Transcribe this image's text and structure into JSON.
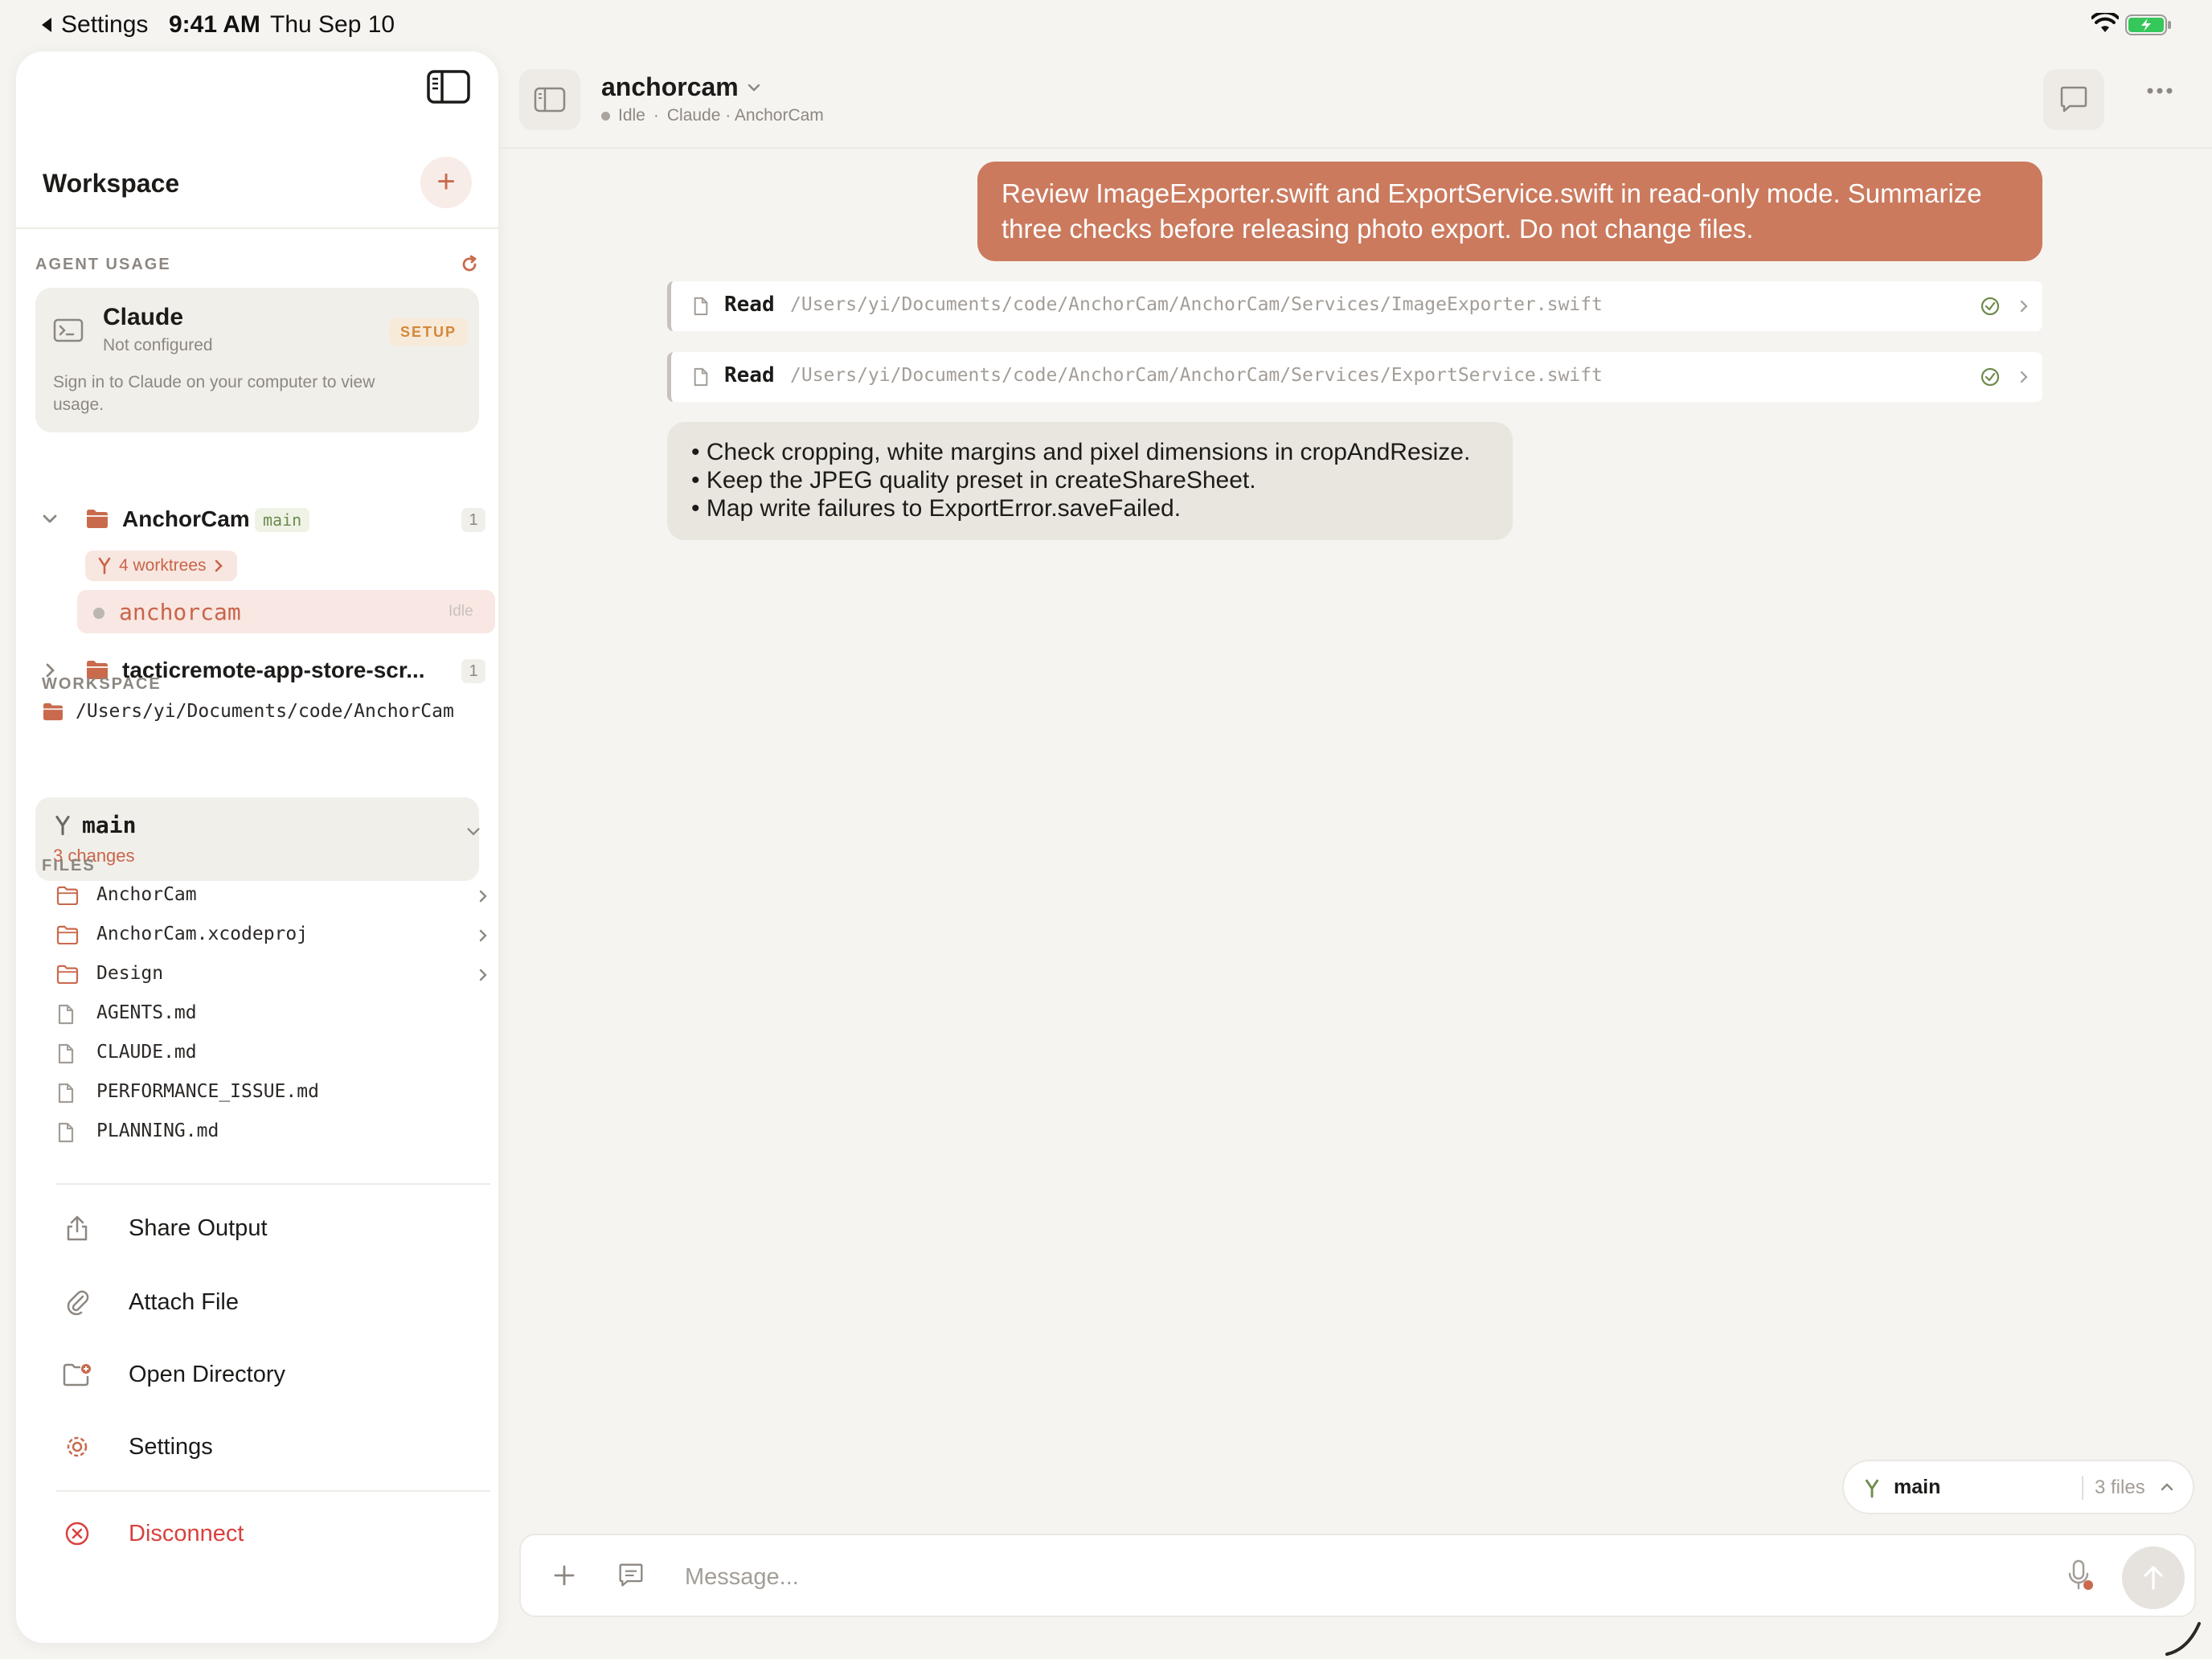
{
  "status_bar": {
    "back_label": "Settings",
    "time": "9:41 AM",
    "date": "Thu Sep 10"
  },
  "sidebar": {
    "title": "Workspace",
    "agent_usage": {
      "label": "AGENT USAGE",
      "provider": "Claude",
      "status": "Not configured",
      "badge": "SETUP",
      "description": "Sign in to Claude on your computer to view usage."
    },
    "projects": [
      {
        "name": "AnchorCam",
        "branch_badge": "main",
        "count": "1",
        "worktrees": "4 worktrees",
        "sessions": [
          {
            "name": "anchorcam",
            "status": "Idle"
          }
        ]
      },
      {
        "name": "tacticremote-app-store-scr...",
        "count": "1"
      }
    ],
    "workspace": {
      "label": "WORKSPACE",
      "path": "/Users/yi/Documents/code/AnchorCam",
      "branch": "main",
      "changes": "3 changes"
    },
    "files": {
      "label": "FILES",
      "items": [
        {
          "name": "AnchorCam",
          "type": "folder"
        },
        {
          "name": "AnchorCam.xcodeproj",
          "type": "folder"
        },
        {
          "name": "Design",
          "type": "folder"
        },
        {
          "name": "AGENTS.md",
          "type": "file"
        },
        {
          "name": "CLAUDE.md",
          "type": "file"
        },
        {
          "name": "PERFORMANCE_ISSUE.md",
          "type": "file"
        },
        {
          "name": "PLANNING.md",
          "type": "file"
        }
      ]
    },
    "actions": {
      "share": "Share Output",
      "attach": "Attach File",
      "open_dir": "Open Directory",
      "settings": "Settings",
      "disconnect": "Disconnect"
    }
  },
  "header": {
    "title": "anchorcam",
    "status": "Idle",
    "separator": "·",
    "context": "Claude · AnchorCam"
  },
  "conversation": {
    "user_message": "Review ImageExporter.swift and ExportService.swift in read-only mode. Summarize three checks before releasing photo export. Do not change files.",
    "tool_calls": [
      {
        "verb": "Read",
        "path": "/Users/yi/Documents/code/AnchorCam/AnchorCam/Services/ImageExporter.swift"
      },
      {
        "verb": "Read",
        "path": "/Users/yi/Documents/code/AnchorCam/AnchorCam/Services/ExportService.swift"
      }
    ],
    "assistant_lines": [
      "• Check cropping, white margins and pixel dimensions in cropAndResize.",
      "• Keep the JPEG quality preset in createShareSheet.",
      "• Map write failures to ExportError.saveFailed."
    ]
  },
  "branch_pill": {
    "branch": "main",
    "files": "3 files"
  },
  "composer": {
    "placeholder": "Message..."
  },
  "colors": {
    "accent": "#cb7a5e",
    "danger": "#d9413d",
    "background": "#f6f4f0"
  }
}
